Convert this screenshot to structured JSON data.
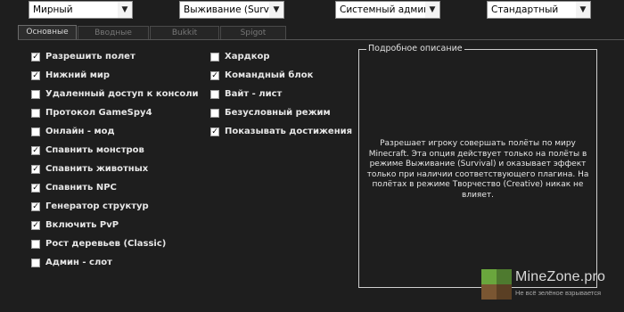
{
  "dropdowns": [
    {
      "value": "Мирный"
    },
    {
      "value": "Выживание (Survival"
    },
    {
      "value": "Системный админ"
    },
    {
      "value": "Стандартный"
    }
  ],
  "tabs": [
    {
      "label": "Основные",
      "active": true
    },
    {
      "label": "Вводные",
      "active": false
    },
    {
      "label": "Bukkit",
      "active": false
    },
    {
      "label": "Spigot",
      "active": false
    }
  ],
  "options_left": [
    {
      "label": "Разрешить полет",
      "checked": true
    },
    {
      "label": "Нижний мир",
      "checked": true
    },
    {
      "label": "Удаленный доступ к консоли",
      "checked": false
    },
    {
      "label": "Протокол GameSpy4",
      "checked": false
    },
    {
      "label": "Онлайн - мод",
      "checked": false
    },
    {
      "label": "Спавнить монстров",
      "checked": true
    },
    {
      "label": "Спавнить животных",
      "checked": true
    },
    {
      "label": "Спавнить NPC",
      "checked": true
    },
    {
      "label": "Генератор структур",
      "checked": true
    },
    {
      "label": "Включить PvP",
      "checked": true
    },
    {
      "label": "Рост деревьев (Classic)",
      "checked": false
    },
    {
      "label": "Админ - слот",
      "checked": false
    }
  ],
  "options_right": [
    {
      "label": "Хардкор",
      "checked": false
    },
    {
      "label": "Командный блок",
      "checked": true
    },
    {
      "label": "Вайт - лист",
      "checked": false
    },
    {
      "label": "Безусловный режим",
      "checked": false
    },
    {
      "label": "Показывать достижения",
      "checked": true
    }
  ],
  "description": {
    "legend": "Подробное описание",
    "text": "Разрешает игроку совершать полёты по миру Minecraft. Эта опция действует только на полёты в режиме Выживание (Survival) и оказывает эффект только при наличии соответствующего плагина. На полётах в режиме Творчество (Creative) никак не влияет."
  },
  "watermark": {
    "brand": "MineZone.pro",
    "tagline": "Не всё зелёное взрывается"
  },
  "colors": {
    "background": "#1e1e1e",
    "cube_green_dark": "#4e7a2f",
    "cube_green_light": "#6aa63d",
    "cube_brown": "#7a5632"
  }
}
